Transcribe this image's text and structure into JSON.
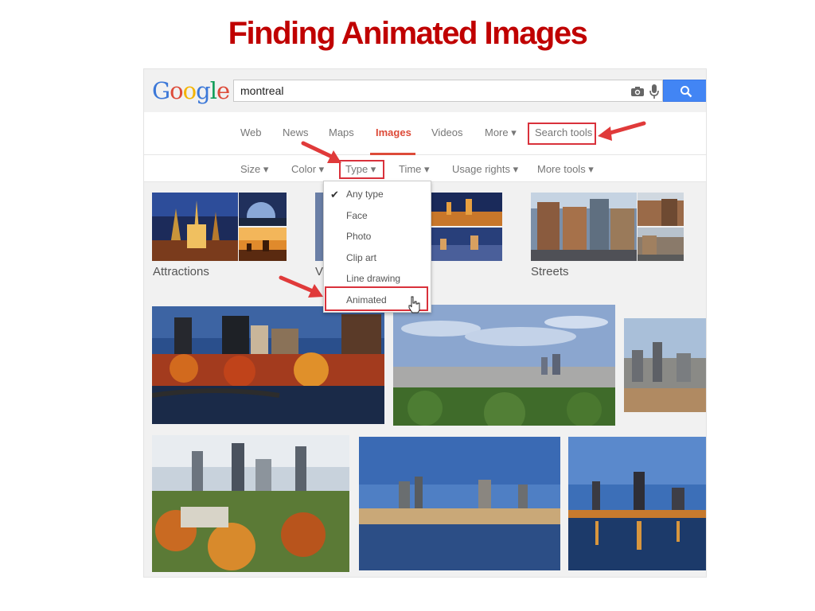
{
  "slide": {
    "title": "Finding Animated Images"
  },
  "google": {
    "logo_letters": [
      {
        "ch": "G",
        "color": "#3c78d8"
      },
      {
        "ch": "o",
        "color": "#dd4b39"
      },
      {
        "ch": "o",
        "color": "#f4b400"
      },
      {
        "ch": "g",
        "color": "#3c78d8"
      },
      {
        "ch": "l",
        "color": "#0f9d58"
      },
      {
        "ch": "e",
        "color": "#dd4b39"
      }
    ],
    "search_value": "montreal",
    "accent": "#4285f4"
  },
  "nav": {
    "web": "Web",
    "news": "News",
    "maps": "Maps",
    "images": "Images",
    "videos": "Videos",
    "more": "More ▾",
    "search_tools": "Search tools"
  },
  "tools": {
    "size": "Size ▾",
    "color": "Color ▾",
    "type": "Type ▾",
    "time": "Time ▾",
    "usage_rights": "Usage rights ▾",
    "more_tools": "More tools ▾"
  },
  "type_menu": {
    "checkmark": "✔",
    "items": [
      "Any type",
      "Face",
      "Photo",
      "Clip art",
      "Line drawing",
      "Animated"
    ],
    "selected": "Any type"
  },
  "related": {
    "attractions": "Attractions",
    "partial": "V",
    "streets": "Streets"
  },
  "colors": {
    "highlight": "#d9313b",
    "title": "#c00000",
    "active_tab": "#dd4b39"
  }
}
